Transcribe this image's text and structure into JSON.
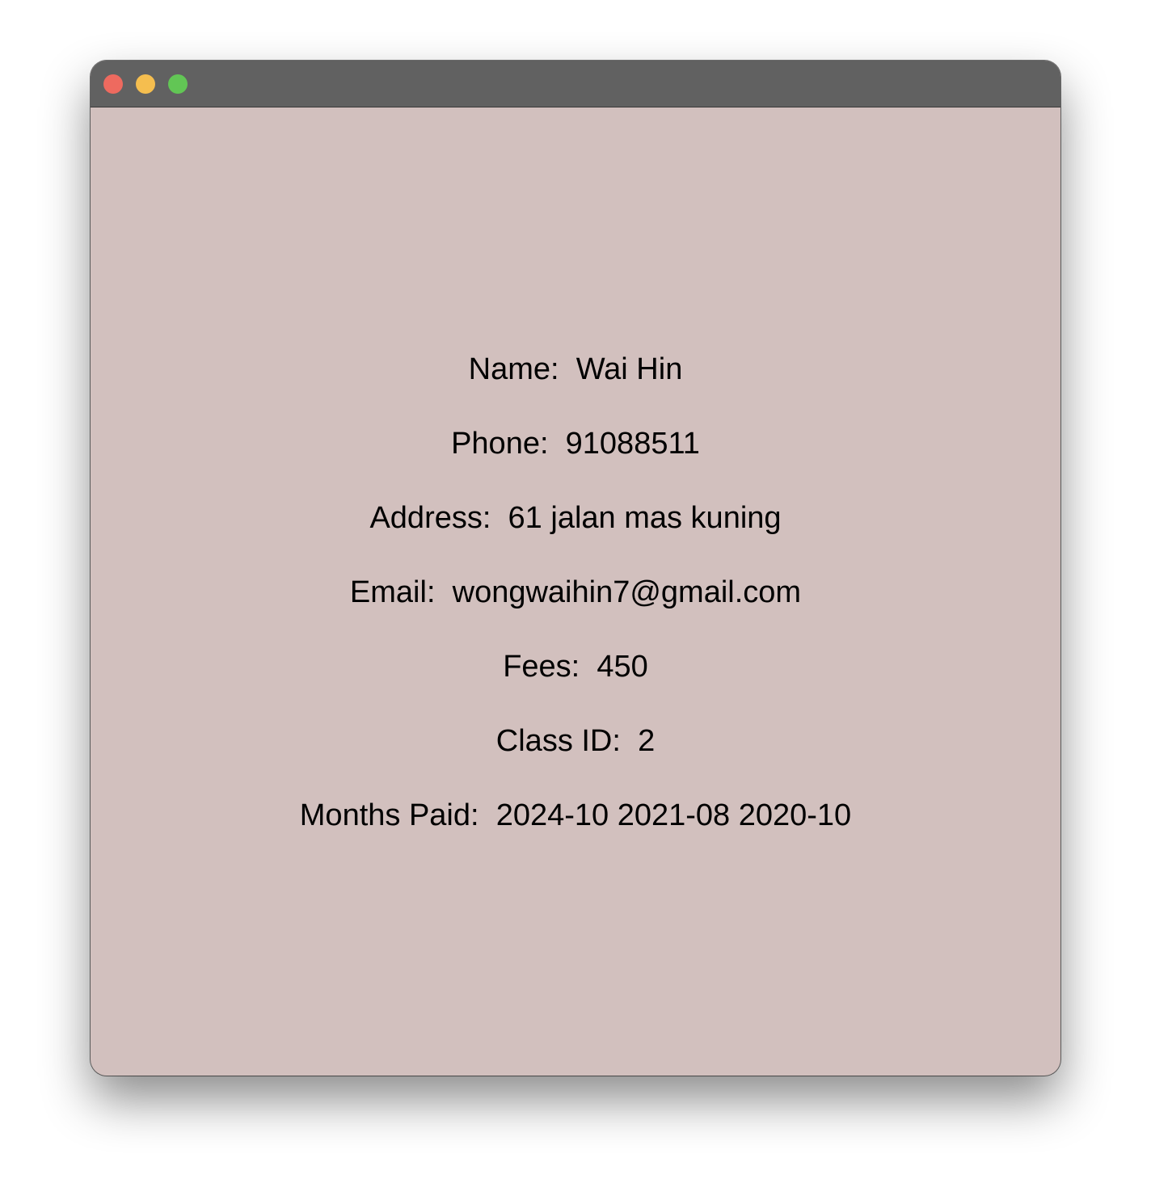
{
  "window": {
    "background_color": "#d2c0be",
    "titlebar_color": "#616161",
    "traffic_lights": {
      "close_color": "#ee6a5f",
      "minimize_color": "#f5be4f",
      "maximize_color": "#62c655"
    }
  },
  "student": {
    "name_label": "Name:",
    "name_value": "Wai Hin",
    "phone_label": "Phone:",
    "phone_value": "91088511",
    "address_label": "Address:",
    "address_value": "61 jalan mas kuning",
    "email_label": "Email:",
    "email_value": "wongwaihin7@gmail.com",
    "fees_label": "Fees:",
    "fees_value": "450",
    "class_id_label": "Class ID:",
    "class_id_value": "2",
    "months_paid_label": "Months Paid:",
    "months_paid_value": "2024-10 2021-08 2020-10"
  }
}
